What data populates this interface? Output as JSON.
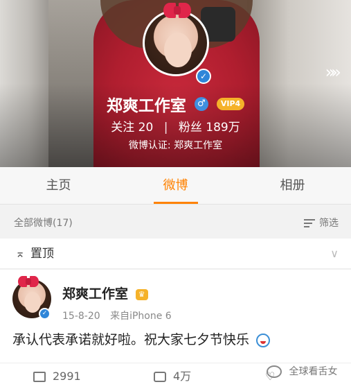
{
  "profile": {
    "name": "郑爽工作室",
    "vip": "VIP4",
    "following_label": "关注",
    "following_count": "20",
    "separator": "|",
    "followers_label": "粉丝",
    "followers_count": "189万",
    "verification": "微博认证: 郑爽工作室",
    "more": "»»"
  },
  "tabs": [
    {
      "label": "主页",
      "active": false
    },
    {
      "label": "微博",
      "active": true
    },
    {
      "label": "相册",
      "active": false
    }
  ],
  "filter_bar": {
    "count_label": "全部微博(17)",
    "filter_label": "筛选"
  },
  "pinned": {
    "label": "置顶",
    "chevron": "∨"
  },
  "post": {
    "author": "郑爽工作室",
    "date": "15-8-20",
    "source": "来自iPhone 6",
    "text": "承认代表承诺就好啦。祝大家七夕节快乐",
    "reposts": "2991",
    "comments": "4万"
  },
  "watermark": "全球看舌女",
  "colors": {
    "accent": "#ff8200",
    "verify_blue": "#2f86d9",
    "vip_gold": "#f5b22a",
    "bow_red": "#e0264a"
  },
  "icons": [
    "verified-icon",
    "gender-male-icon",
    "vip-crown-icon",
    "chevron-right-icon",
    "filter-icon",
    "pin-icon",
    "repost-icon",
    "comment-icon",
    "like-icon",
    "emoji-icon"
  ]
}
